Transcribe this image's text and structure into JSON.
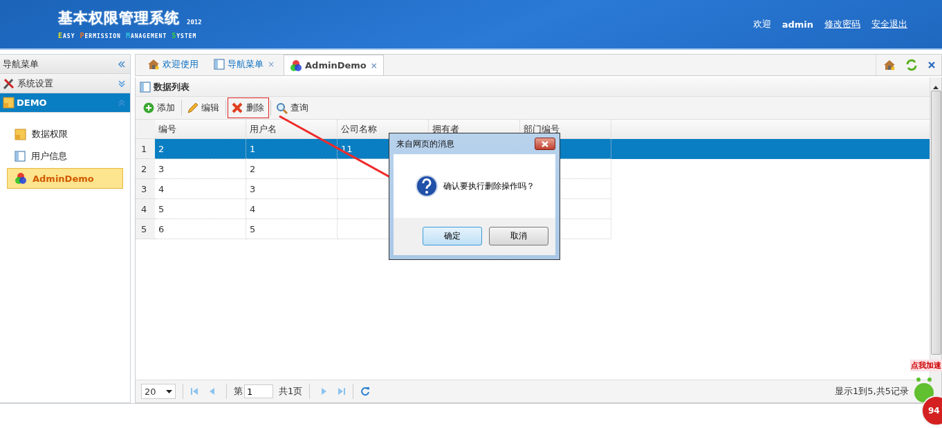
{
  "header": {
    "title": "基本权限管理系统",
    "year": "2012",
    "subtitle": [
      {
        "initial": "E",
        "rest": "ASY",
        "color": "#e8e020"
      },
      {
        "initial": "P",
        "rest": "ERMISSION",
        "color": "#f07020"
      },
      {
        "initial": "M",
        "rest": "ANAGEMENT",
        "color": "#30c0e0"
      },
      {
        "initial": "S",
        "rest": "YSTEM",
        "color": "#40d040"
      }
    ],
    "welcome": "欢迎",
    "user": "admin",
    "links": [
      "修改密码",
      "安全退出"
    ]
  },
  "sidebar": {
    "title": "导航菜单",
    "groups": [
      {
        "label": "系统设置",
        "expanded": false
      },
      {
        "label": "DEMO",
        "expanded": true
      }
    ],
    "items": [
      {
        "label": "数据权限",
        "selected": false
      },
      {
        "label": "用户信息",
        "selected": false
      },
      {
        "label": "AdminDemo",
        "selected": true
      }
    ]
  },
  "tabs": [
    {
      "label": "欢迎使用",
      "closable": false,
      "selected": false
    },
    {
      "label": "导航菜单",
      "closable": true,
      "selected": false
    },
    {
      "label": "AdminDemo",
      "closable": true,
      "selected": true
    }
  ],
  "close_mark": "×",
  "panel": {
    "title": "数据列表",
    "toolbar": [
      {
        "label": "添加",
        "highlighted": false
      },
      {
        "label": "编辑",
        "highlighted": false
      },
      {
        "label": "删除",
        "highlighted": true
      },
      {
        "label": "查询",
        "highlighted": false
      }
    ]
  },
  "table": {
    "columns": [
      "编号",
      "用户名",
      "公司名称",
      "拥有者",
      "部门编号"
    ],
    "rows": [
      {
        "number": "1",
        "cells": [
          "2",
          "1",
          "11"
        ],
        "selected": true
      },
      {
        "number": "2",
        "cells": [
          "3",
          "2"
        ],
        "selected": false
      },
      {
        "number": "3",
        "cells": [
          "4",
          "3"
        ],
        "selected": false
      },
      {
        "number": "4",
        "cells": [
          "5",
          "4"
        ],
        "selected": false
      },
      {
        "number": "5",
        "cells": [
          "6",
          "5"
        ],
        "selected": false
      }
    ]
  },
  "pager": {
    "page_size": "20",
    "page_label": "第",
    "page": "1",
    "total_pages": "共1页",
    "summary": "显示1到5,共5记录"
  },
  "dialog": {
    "title": "来自网页的消息",
    "message": "确认要执行删除操作吗？",
    "buttons": [
      {
        "label": "确定",
        "selected": true
      },
      {
        "label": "取消",
        "selected": false
      }
    ]
  },
  "widget": {
    "label": "点我加速",
    "count": "94"
  }
}
